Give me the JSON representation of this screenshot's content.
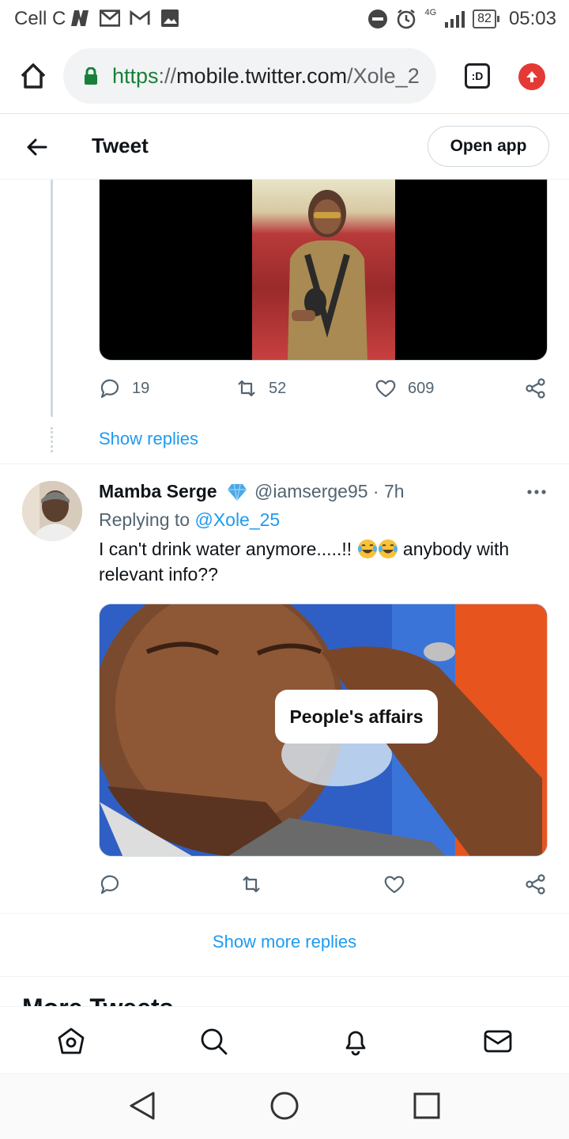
{
  "status_bar": {
    "carrier": "Cell C",
    "battery": "82",
    "time": "05:03",
    "network": "4G"
  },
  "browser": {
    "url_scheme": "https",
    "url_sep": "://",
    "url_host": "mobile.twitter.com",
    "url_path": "/Xole_2",
    "tabs_label": ":D"
  },
  "header": {
    "title": "Tweet",
    "open_app": "Open app"
  },
  "first_tweet": {
    "replies": "19",
    "retweets": "52",
    "likes": "609",
    "show_replies": "Show replies"
  },
  "second_tweet": {
    "name": "Mamba Serge",
    "handle": "@iamserge95 · 7h",
    "replying_prefix": "Replying to",
    "replying_to": "@Xole_25",
    "text_before_emoji": "I can't drink water anymore.....!!",
    "text_after_emoji": "anybody with relevant info??",
    "meme_caption": "People's affairs"
  },
  "show_more_replies": "Show more replies",
  "more_tweets_heading": "More Tweets",
  "colors": {
    "twitter_blue": "#1d9bf0",
    "secondary_text": "#536471",
    "url_green": "#188038"
  }
}
